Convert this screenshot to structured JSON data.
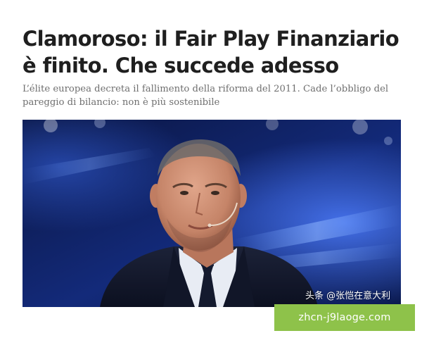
{
  "article": {
    "headline": "Clamoroso: il Fair Play Finanziario è finito. Che succede adesso",
    "subheading": "L’élite europea decreta il fallimento della riforma del 2011. Cade l’obbligo del pareggio di bilancio: non è più sostenibile",
    "image": {
      "description_icon": "photo-speaker-at-stage",
      "watermark": "头条 @张恺在意大利"
    }
  },
  "overlay": {
    "site_badge": "zhcn-j9laoge.com",
    "badge_color": "#8ec24a"
  },
  "colors": {
    "headline": "#1f1f1f",
    "subheading": "#6f6f6f",
    "stage_blue": "#1b3a9a"
  }
}
